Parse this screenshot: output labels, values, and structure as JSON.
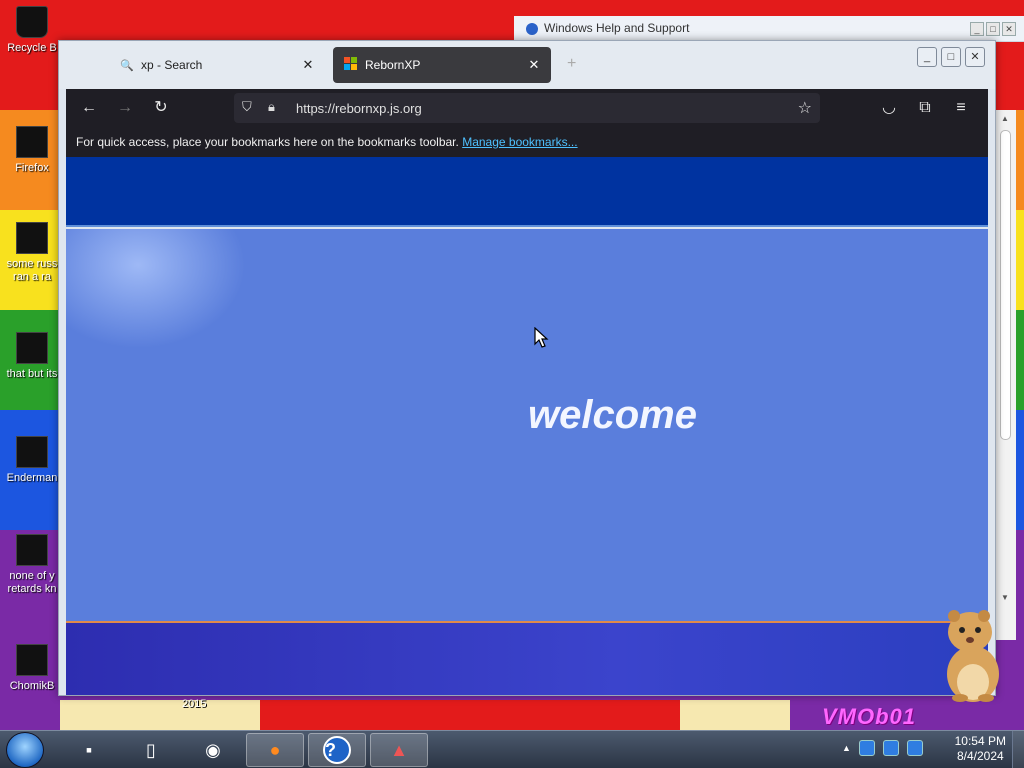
{
  "desktop": {
    "icons": [
      {
        "label": "Recycle B",
        "icon": "recycle-bin-icon"
      },
      {
        "label": "Firefox",
        "icon": "firefox-icon"
      },
      {
        "label": "some russ\nran a ra",
        "icon": "file-icon"
      },
      {
        "label": "that but its",
        "icon": "folder-icon"
      },
      {
        "label": "Enderman",
        "icon": "window-icon"
      },
      {
        "label": "none of y\nretards kn",
        "icon": "file-icon"
      },
      {
        "label": "ChomikB",
        "icon": "window-icon"
      }
    ],
    "year_text": "2015",
    "watermark": "VMOb01"
  },
  "help_window": {
    "title": "Windows Help and Support"
  },
  "firefox": {
    "tabs": [
      {
        "label": "xp - Search",
        "icon": "search-icon",
        "active": false
      },
      {
        "label": "RebornXP",
        "icon": "windows-logo-icon",
        "active": true
      }
    ],
    "new_tab_icon": "plus-icon",
    "url": "https://rebornxp.js.org",
    "bookmarks_text": "For quick access, place your bookmarks here on the bookmarks toolbar.",
    "bookmarks_link": "Manage bookmarks...",
    "page": {
      "welcome": "welcome",
      "colors": {
        "top": "#0033a0",
        "middle": "#5a7edc",
        "bottom": "#2d2db0"
      }
    }
  },
  "taskbar": {
    "items": [
      {
        "name": "terminal",
        "icon": "terminal-icon",
        "active": false
      },
      {
        "name": "tablet",
        "icon": "tablet-icon",
        "active": false
      },
      {
        "name": "globe",
        "icon": "globe-icon",
        "active": false
      },
      {
        "name": "firefox",
        "icon": "firefox-icon",
        "active": true
      },
      {
        "name": "help",
        "icon": "help-icon",
        "active": true
      },
      {
        "name": "app",
        "icon": "app-icon",
        "active": true
      }
    ],
    "clock_time": "10:54 PM",
    "clock_date": "8/4/2024"
  }
}
